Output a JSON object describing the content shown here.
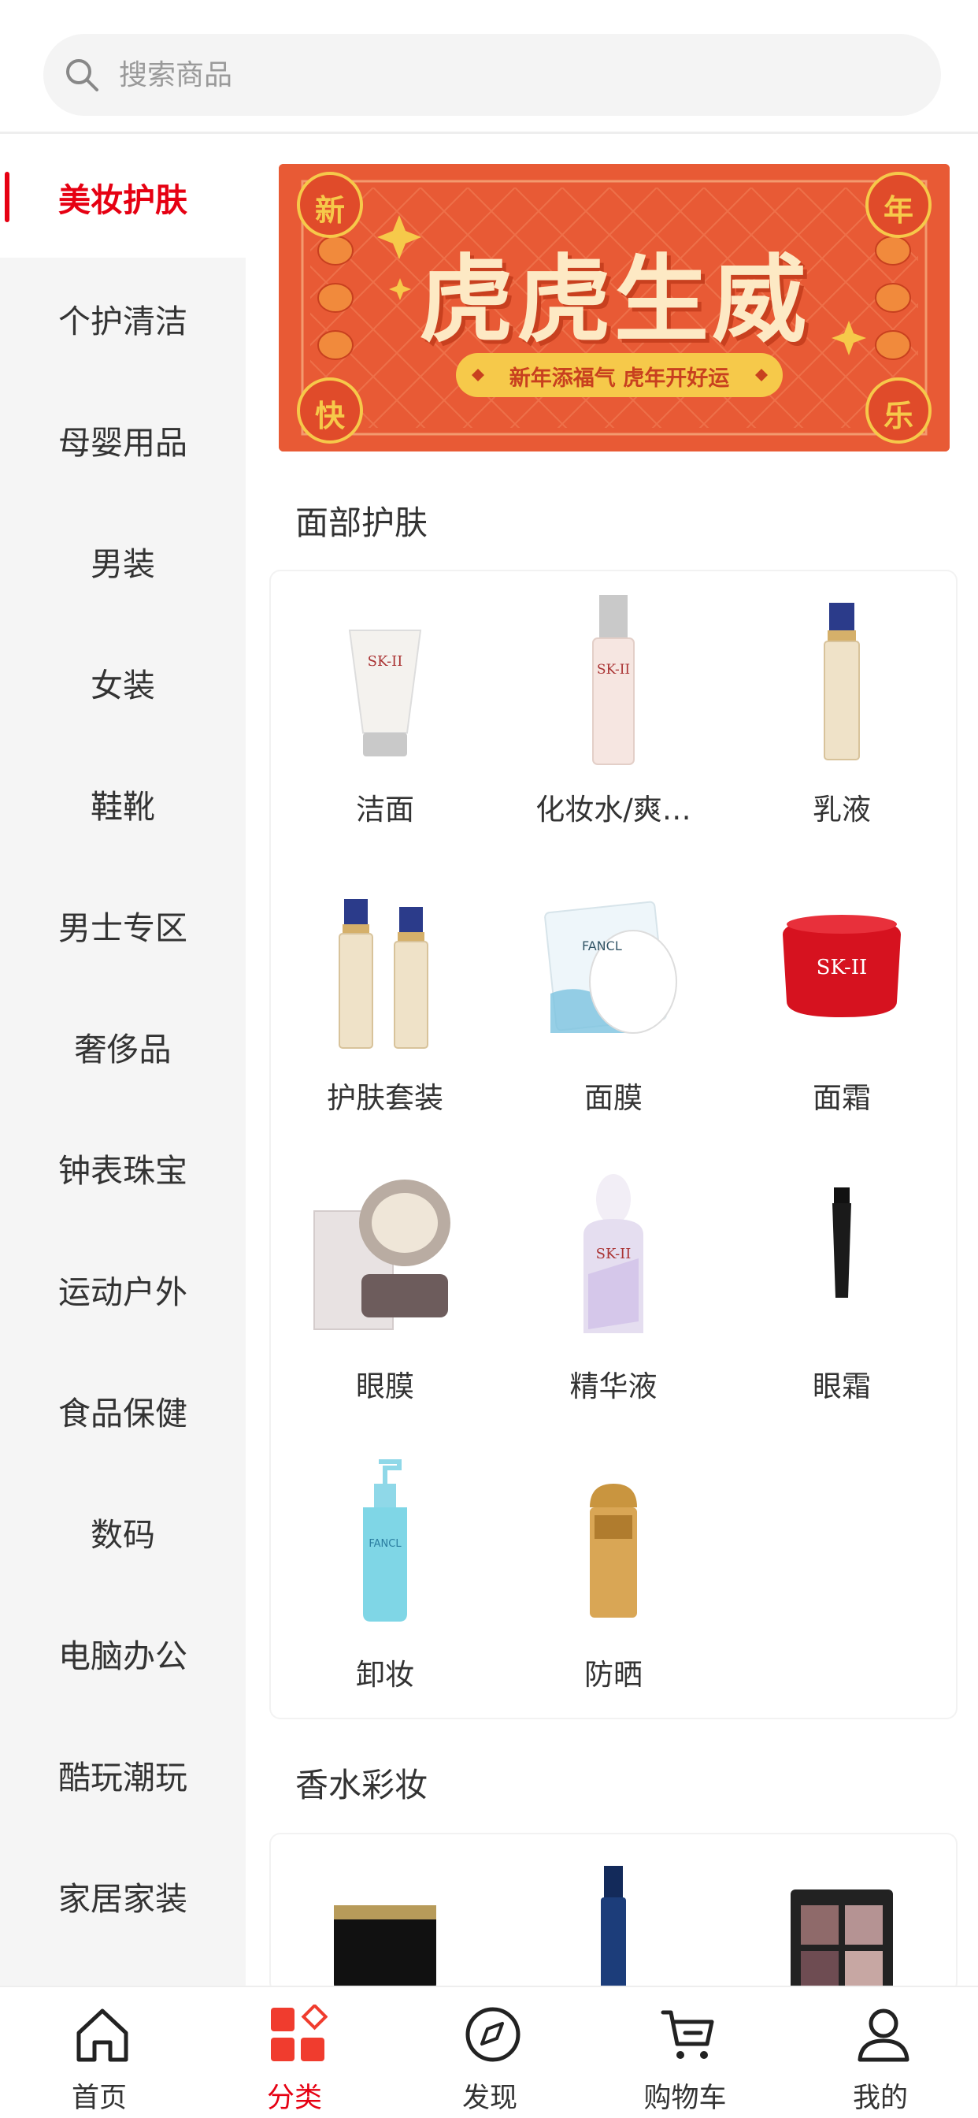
{
  "search": {
    "placeholder": "搜索商品"
  },
  "sidebar": {
    "items": [
      {
        "label": "美妆护肤",
        "active": true
      },
      {
        "label": "个护清洁"
      },
      {
        "label": "母婴用品"
      },
      {
        "label": "男装"
      },
      {
        "label": "女装"
      },
      {
        "label": "鞋靴"
      },
      {
        "label": "男士专区"
      },
      {
        "label": "奢侈品"
      },
      {
        "label": "钟表珠宝"
      },
      {
        "label": "运动户外"
      },
      {
        "label": "食品保健"
      },
      {
        "label": "数码"
      },
      {
        "label": "电脑办公"
      },
      {
        "label": "酷玩潮玩"
      },
      {
        "label": "家居家装"
      }
    ]
  },
  "banner": {
    "title": "虎虎生威",
    "subtitle": "新年添福气 虎年开好运",
    "corner_chars": [
      "新",
      "年",
      "快",
      "乐"
    ],
    "bg_color": "#e85a35",
    "accent_color": "#f6c94a"
  },
  "sections": [
    {
      "title": "面部护肤",
      "items": [
        {
          "label": "洁面",
          "icon": "cleanser-tube-icon"
        },
        {
          "label": "化妆水/爽…",
          "icon": "toner-bottle-icon"
        },
        {
          "label": "乳液",
          "icon": "lotion-bottle-icon"
        },
        {
          "label": "护肤套装",
          "icon": "skincare-set-icon"
        },
        {
          "label": "面膜",
          "icon": "face-mask-icon"
        },
        {
          "label": "面霜",
          "icon": "cream-jar-icon"
        },
        {
          "label": "眼膜",
          "icon": "eye-mask-jar-icon"
        },
        {
          "label": "精华液",
          "icon": "serum-bottle-icon"
        },
        {
          "label": "眼霜",
          "icon": "eye-cream-icon"
        },
        {
          "label": "卸妆",
          "icon": "makeup-remover-icon"
        },
        {
          "label": "防晒",
          "icon": "sunscreen-icon"
        }
      ]
    },
    {
      "title": "香水彩妆",
      "items": [
        {
          "label": "",
          "icon": "cream-jar-black-icon"
        },
        {
          "label": "",
          "icon": "foundation-bottle-icon"
        },
        {
          "label": "",
          "icon": "eyeshadow-palette-icon"
        }
      ]
    }
  ],
  "bottom_nav": [
    {
      "label": "首页",
      "icon": "home-icon"
    },
    {
      "label": "分类",
      "icon": "category-icon",
      "active": true
    },
    {
      "label": "发现",
      "icon": "compass-icon"
    },
    {
      "label": "购物车",
      "icon": "cart-icon"
    },
    {
      "label": "我的",
      "icon": "user-icon"
    }
  ],
  "colors": {
    "accent": "#e60012",
    "sidebar_bg": "#f5f5f5"
  }
}
